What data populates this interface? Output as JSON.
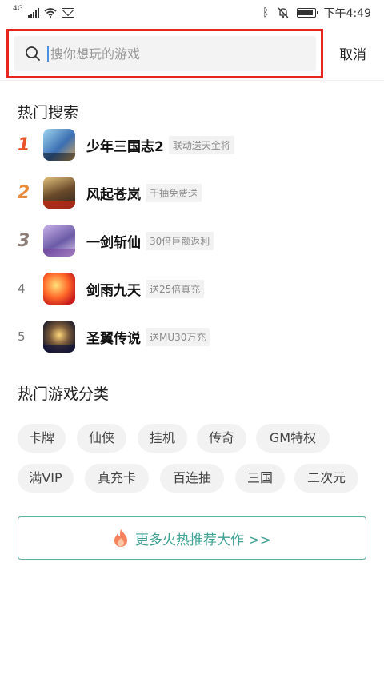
{
  "status_bar": {
    "network": "4G",
    "time": "下午4:49"
  },
  "search": {
    "placeholder": "搜你想玩的游戏",
    "cancel_label": "取消",
    "highlight_color": "#e8261d"
  },
  "hot_search": {
    "title": "热门搜索",
    "items": [
      {
        "rank": "1",
        "name": "少年三国志2",
        "tag": "联动送天金将",
        "rank_color": "#e8532a"
      },
      {
        "rank": "2",
        "name": "风起苍岚",
        "tag": "千抽免费送",
        "rank_color": "#e98a3d"
      },
      {
        "rank": "3",
        "name": "一剑斩仙",
        "tag": "30倍巨额返利",
        "rank_color": "#8c7d76"
      },
      {
        "rank": "4",
        "name": "剑雨九天",
        "tag": "送25倍真充",
        "rank_color": "#777777"
      },
      {
        "rank": "5",
        "name": "圣翼传说",
        "tag": "送MU30万充",
        "rank_color": "#777777"
      }
    ]
  },
  "categories": {
    "title": "热门游戏分类",
    "items": [
      "卡牌",
      "仙侠",
      "挂机",
      "传奇",
      "GM特权",
      "满VIP",
      "真充卡",
      "百连抽",
      "三国",
      "二次元"
    ]
  },
  "more_button": {
    "label": "更多火热推荐大作 >>",
    "accent_color": "#3fa294"
  }
}
